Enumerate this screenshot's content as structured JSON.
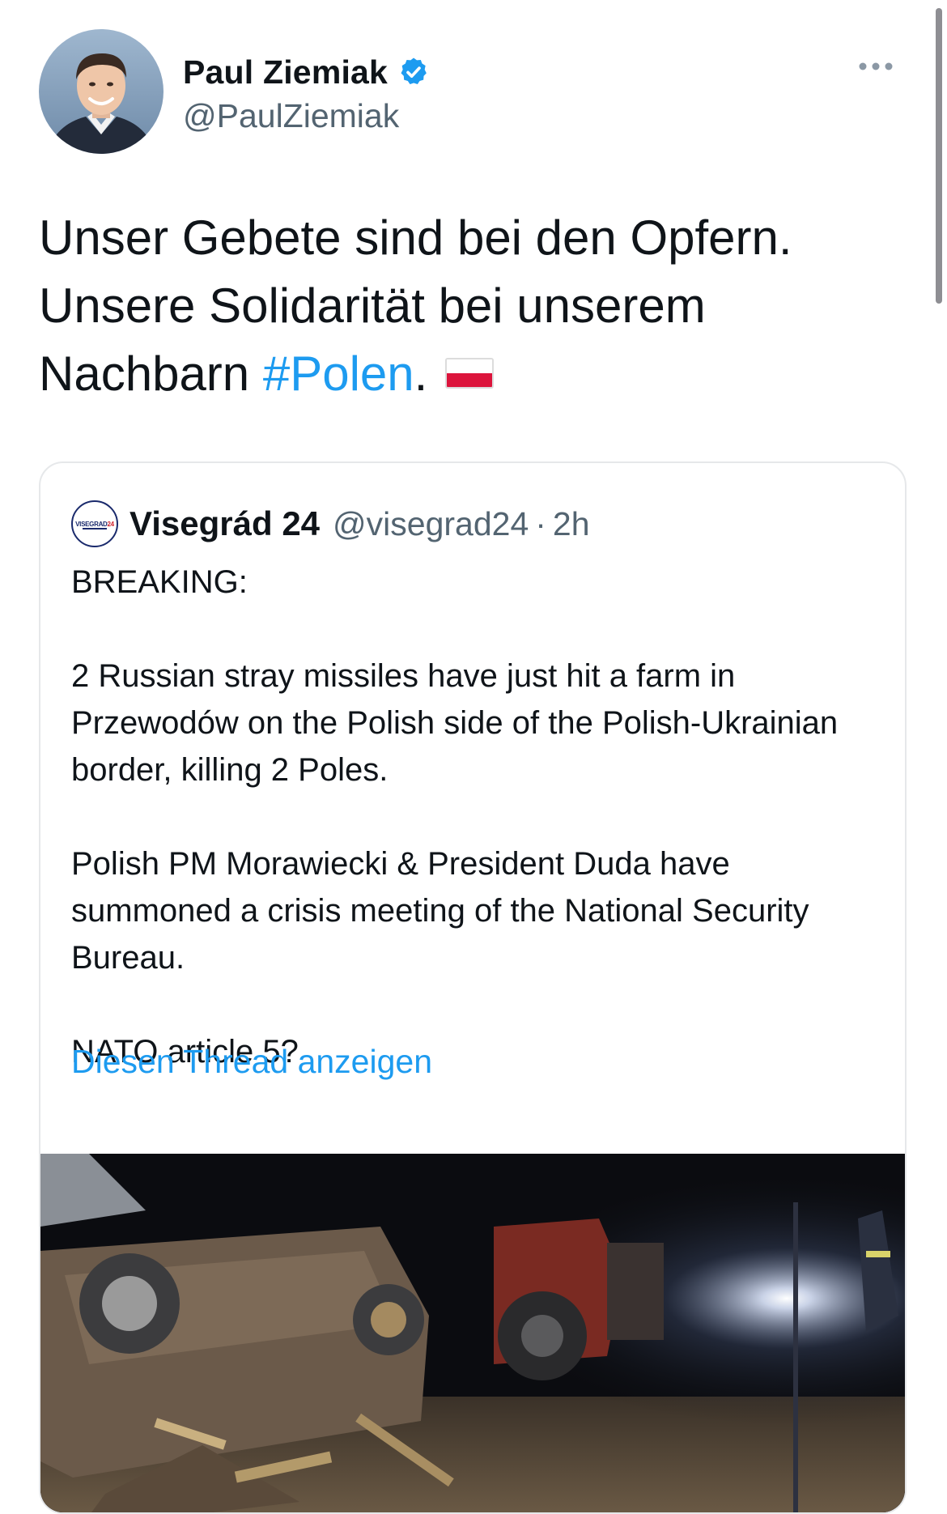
{
  "tweet": {
    "author": {
      "display_name": "Paul Ziemiak",
      "handle": "@PaulZiemiak",
      "verified": true,
      "avatar_icon": "person-portrait"
    },
    "more_icon": "ellipsis-horizontal-icon",
    "text_lines": {
      "line1": "Unser Gebete sind bei den Opfern.",
      "line2": "Unsere Solidarität bei unserem",
      "line3_prefix": "Nachbarn ",
      "hashtag": "#Polen",
      "line3_suffix": "."
    },
    "flag_icon": "poland-flag-emoji"
  },
  "quoted_tweet": {
    "avatar_logo_text": "VISEGRAD",
    "avatar_logo_number": "24",
    "display_name": "Visegrád 24",
    "handle": "@visegrad24",
    "separator": "·",
    "time": "2h",
    "paragraphs": [
      "BREAKING:",
      "2 Russian stray missiles have just hit a farm in Przewodów on the Polish side of the Polish-Ukrainian border, killing 2 Poles.",
      "Polish PM Morawiecki & President Duda have summoned a crisis meeting of the National Security Bureau.",
      "NATO article 5?"
    ],
    "show_thread_label": "Diesen Thread anzeigen",
    "media_description_icon": "photo-night-wreckage"
  },
  "colors": {
    "link": "#1d9bf0",
    "text": "#0f1419",
    "secondary": "#536471",
    "border": "#e6e8ea",
    "verified": "#1d9bf0"
  }
}
